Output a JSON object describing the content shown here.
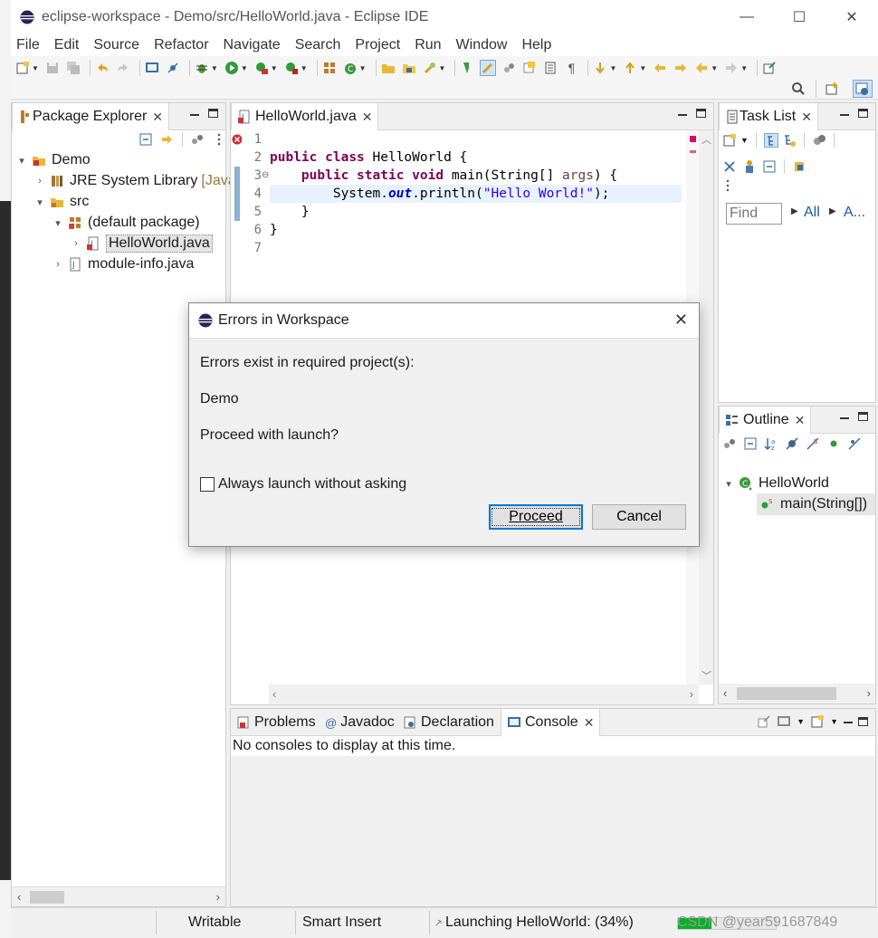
{
  "window": {
    "title": "eclipse-workspace - Demo/src/HelloWorld.java - Eclipse IDE",
    "minimize": "—",
    "maximize": "☐",
    "close": "✕"
  },
  "menu": [
    "File",
    "Edit",
    "Source",
    "Refactor",
    "Navigate",
    "Search",
    "Project",
    "Run",
    "Window",
    "Help"
  ],
  "package_explorer": {
    "tab_label": "Package Explorer",
    "tree": {
      "project": "Demo",
      "jre": "JRE System Library",
      "jre_suffix": "[Java",
      "src": "src",
      "package": "(default package)",
      "file_selected": "HelloWorld.java",
      "module_info": "module-info.java"
    }
  },
  "editor": {
    "tab_label": "HelloWorld.java",
    "line_numbers": [
      "1",
      "2",
      "3",
      "4",
      "5",
      "6",
      "7"
    ],
    "code": {
      "l2_kw1": "public",
      "l2_kw2": "class",
      "l2_rest": " HelloWorld {",
      "l3_kw1": "public",
      "l3_kw2": "static",
      "l3_kw3": "void",
      "l3_mid": " main(String[] ",
      "l3_param": "args",
      "l3_end": ") {",
      "l4_a": "System.",
      "l4_field": "out",
      "l4_b": ".println(",
      "l4_str": "\"Hello World!\"",
      "l4_c": ");",
      "l5": "}",
      "l6": "}"
    }
  },
  "task_list": {
    "tab_label": "Task List",
    "find_placeholder": "Find",
    "all_label": "All",
    "activate_label": "A..."
  },
  "outline": {
    "tab_label": "Outline",
    "class_name": "HelloWorld",
    "method_name": "main(String[])"
  },
  "bottom_panel": {
    "tabs": [
      "Problems",
      "Javadoc",
      "Declaration",
      "Console"
    ],
    "message": "No consoles to display at this time."
  },
  "status_bar": {
    "writable": "Writable",
    "insert_mode": "Smart Insert",
    "launching": "Launching HelloWorld: (34%)",
    "watermark": "CSDN @year591687849"
  },
  "dialog": {
    "title": "Errors in Workspace",
    "message": "Errors exist in required project(s):",
    "project": "Demo",
    "question": "Proceed with launch?",
    "checkbox_label": "Always launch without asking",
    "proceed_label": "Proceed",
    "cancel_label": "Cancel"
  },
  "colors": {
    "keyword": "#7f0055",
    "string": "#2a00ff",
    "field": "#0000c0",
    "focus_border": "#0078d7"
  }
}
